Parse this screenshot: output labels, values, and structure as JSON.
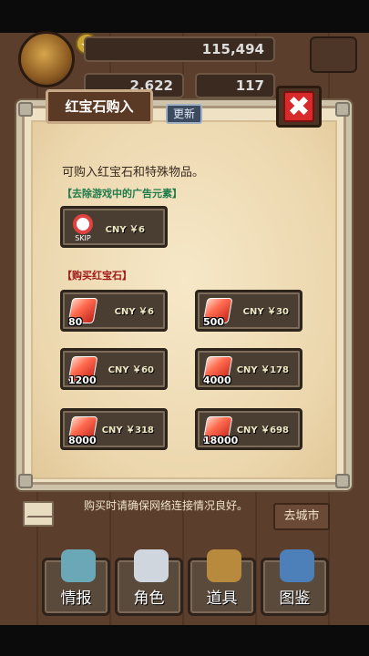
{
  "hud": {
    "gold": "115,494",
    "gems": "2,622",
    "tickets": "117"
  },
  "dialog": {
    "title": "红宝石购入",
    "refresh": "更新",
    "close": "✖",
    "intro": "可购入红宝石和特殊物品。",
    "section_ads": "【去除游戏中的广告元素】",
    "section_rubies": "【购买红宝石】"
  },
  "offers": {
    "skip": {
      "icon_text": "SKIP",
      "price": "CNY ￥6"
    },
    "rubies": [
      {
        "qty": "80",
        "price": "CNY ￥6"
      },
      {
        "qty": "500",
        "price": "CNY ￥30"
      },
      {
        "qty": "1200",
        "price": "CNY ￥60"
      },
      {
        "qty": "4000",
        "price": "CNY ￥178"
      },
      {
        "qty": "8000",
        "price": "CNY ￥318"
      },
      {
        "qty": "18000",
        "price": "CNY ￥698"
      }
    ]
  },
  "footer": {
    "note": "购买时请确保网络连接情况良好。",
    "city_button": "去城市"
  },
  "tabs": [
    {
      "label": "情报"
    },
    {
      "label": "角色"
    },
    {
      "label": "道具"
    },
    {
      "label": "图鉴"
    }
  ],
  "colors": {
    "green_section": "#1d7a4a",
    "red_section": "#a01818",
    "close_red": "#d82a2a",
    "gem_red": "#ff6b4f"
  }
}
